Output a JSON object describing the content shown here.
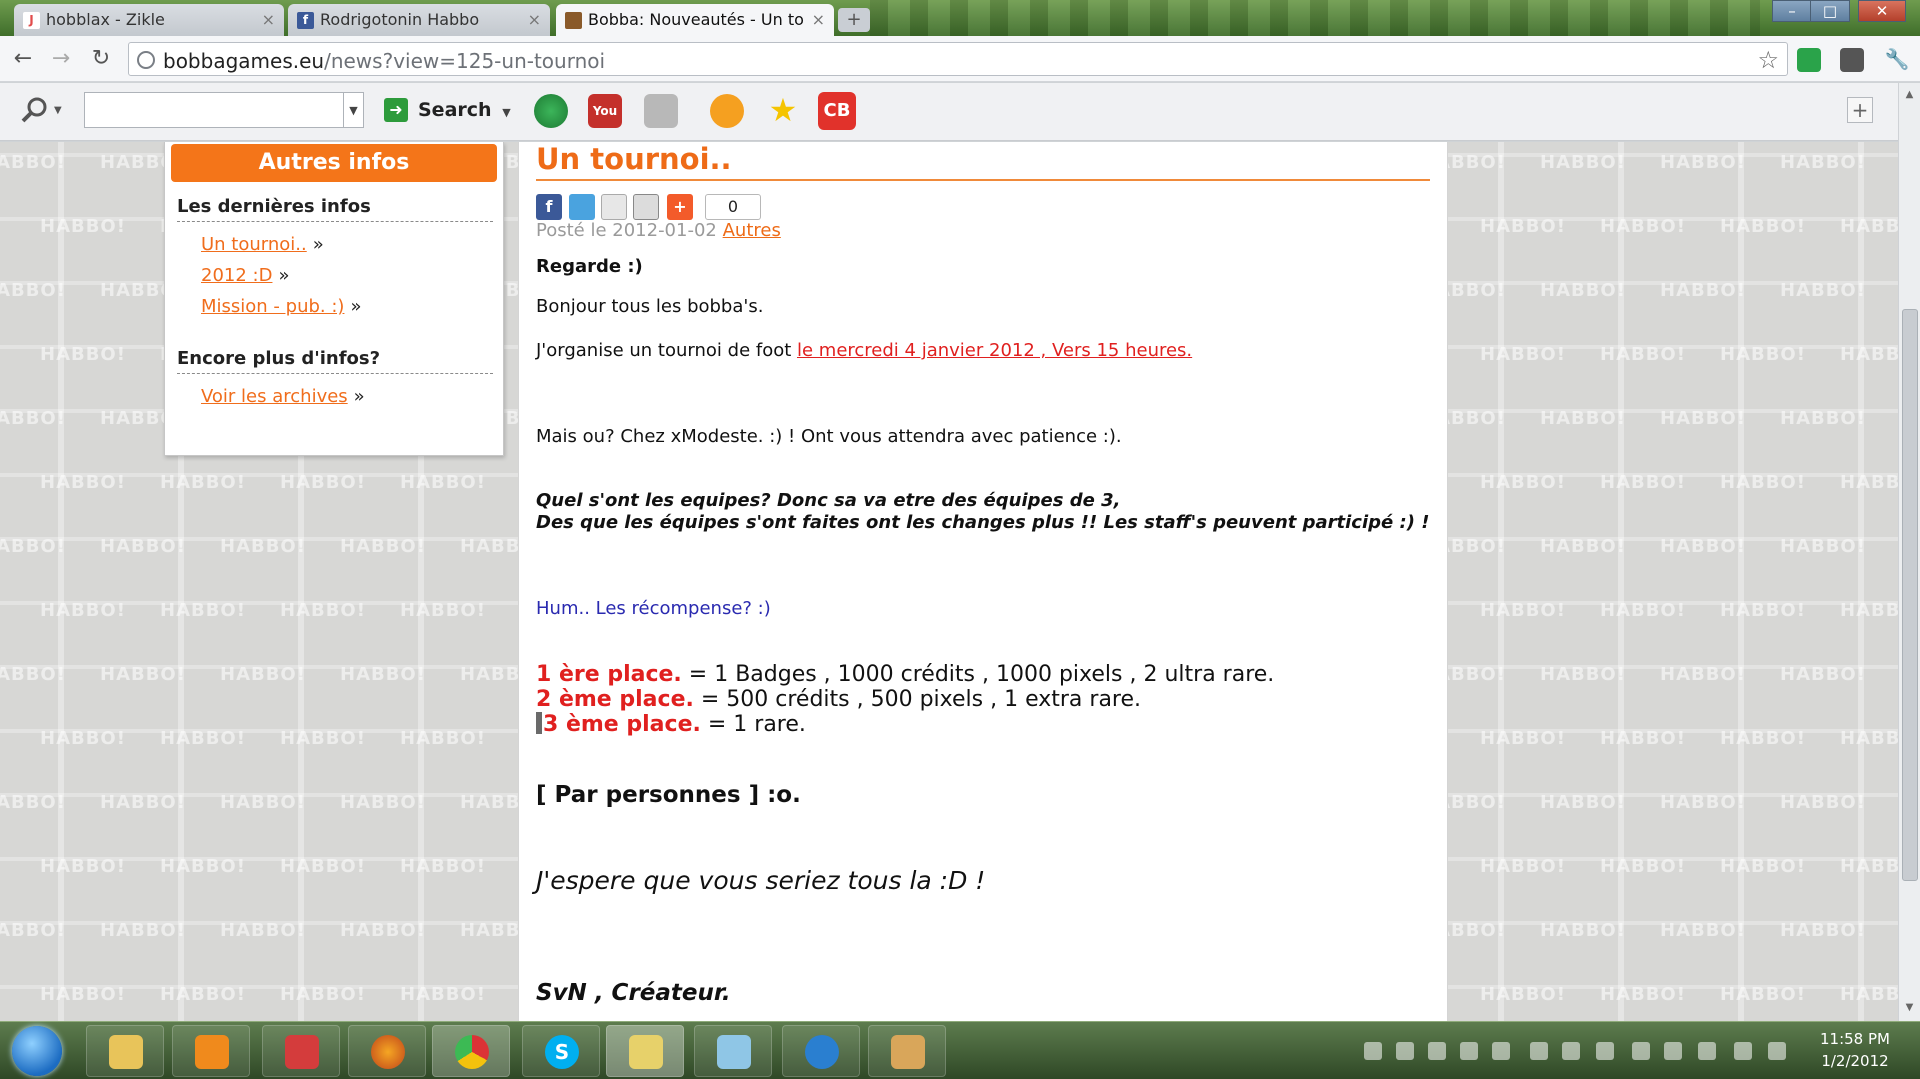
{
  "browser": {
    "tabs": [
      {
        "label": "hobblax - Zikle",
        "favicon_letter": "J",
        "favicon_color": "#e14c4c"
      },
      {
        "label": "Rodrigotonin Habbo",
        "favicon_letter": "f",
        "favicon_color": "#3b5998"
      },
      {
        "label": "Bobba: Nouveautés - Un to",
        "favicon_letter": "",
        "favicon_color": "#8a5a2a"
      }
    ],
    "url_host": "bobbagames.eu",
    "url_path": "/news?view=125-un-tournoi"
  },
  "toolbar": {
    "search_label": "Search",
    "search_value": "",
    "tools": [
      "globe-icon",
      "youtube-icon",
      "game-icon",
      "orange-circle-icon",
      "star-icon",
      "cb-icon"
    ],
    "youtube_label": "You",
    "cb_label": "CB"
  },
  "sidebar": {
    "header": "Autres infos",
    "section1_title": "Les dernières infos",
    "links": [
      {
        "label": "Un tournoi.."
      },
      {
        "label": "2012 :D"
      },
      {
        "label": "Mission - pub. :)"
      }
    ],
    "section2_title": "Encore plus d'infos?",
    "archive_link": "Voir les archives",
    "raquo": "»"
  },
  "article": {
    "title": "Un tournoi..",
    "share_count": "0",
    "posted_prefix": "Posté le 2012-01-02",
    "category": "Autres",
    "lines": {
      "regarde": "Regarde :)",
      "bonjour": "Bonjour tous les bobba's.",
      "organise_prefix": "J'organise un tournoi de foot ",
      "organise_link": "le mercredi 4 janvier 2012 , Vers 15 heures.",
      "mais_ou": "Mais ou? Chez xModeste. :) ! Ont vous attendra avec patience :).",
      "equipes1": "Quel s'ont les equipes? Donc sa va etre des équipes de 3,",
      "equipes2": "Des que les équipes s'ont faites ont les changes plus !! Les staff's peuvent participé :) !",
      "recompense": "Hum.. Les récompense? :)",
      "par_personnes": "[ Par personnes ] :o.",
      "espere": "J'espere que vous seriez tous la :D !",
      "signature": "SvN , Créateur."
    },
    "prizes": [
      {
        "place": "1 ère place.",
        "reward": " = 1 Badges , 1000 crédits , 1000 pixels , 2 ultra rare."
      },
      {
        "place": "2 ème place.",
        "reward": " = 500 crédits , 500 pixels , 1  extra rare."
      },
      {
        "place": "3 ème place.",
        "reward": " = 1 rare."
      }
    ]
  },
  "background_word": "HABBO!",
  "taskbar": {
    "time": "11:58 PM",
    "date": "1/2/2012",
    "skype_letter": "S"
  },
  "colors": {
    "accent_orange": "#f47519",
    "link_red": "#e0201f",
    "recompense_blue": "#2a2ab0"
  }
}
